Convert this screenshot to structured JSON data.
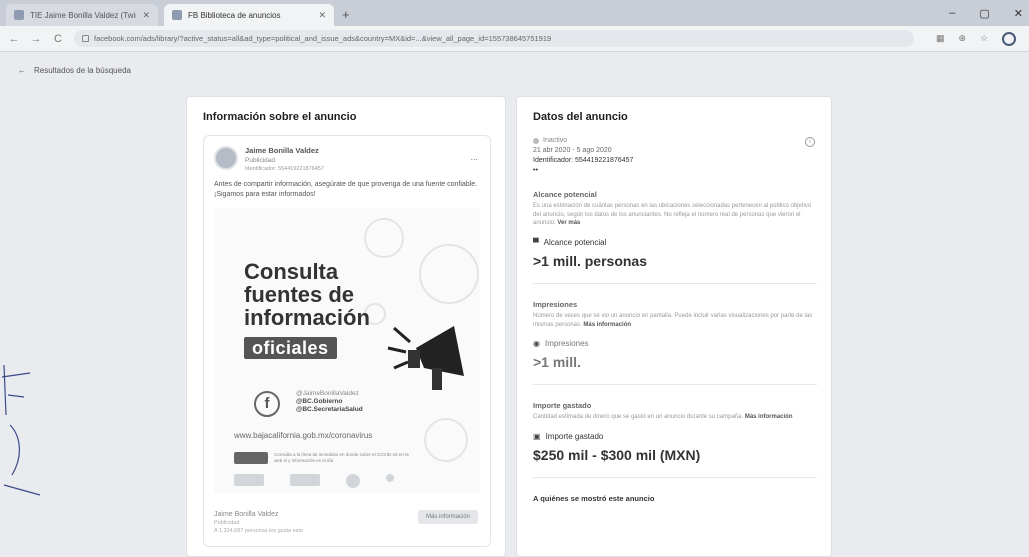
{
  "browser": {
    "tabs": [
      {
        "label": "TIE Jaime Bonilla Valdez (Twin)...",
        "active": false
      },
      {
        "label": "FB Biblioteca de anuncios",
        "active": true
      }
    ],
    "new_tab": "+",
    "window_controls": {
      "minimize": "–",
      "maximize": "▢",
      "close": "✕"
    },
    "nav": {
      "back": "←",
      "forward": "→",
      "reload": "C"
    },
    "url": "facebook.com/ads/library/?active_status=all&ad_type=political_and_issue_ads&country=MX&id=...&view_all_page_id=155738645751919"
  },
  "back_link": {
    "arrow": "←",
    "label": "Resultados de la búsqueda"
  },
  "left_panel": {
    "title": "Información sobre el anuncio",
    "ad": {
      "page_name": "Jaime Bonilla Valdez",
      "sponsored": "Publicidad",
      "sponsor_line": "Identificador: 554419221876457",
      "more": "...",
      "text": "Antes de compartir información, asegúrate de que provenga de una fuente confiable. ¡Sigamos para estar informados!",
      "creative": {
        "headline": [
          "Consulta",
          "fuentes de",
          "información"
        ],
        "highlight": "oficiales",
        "fb_letter": "f",
        "handles": [
          "@JaimeBonillaValdez",
          "@BC.Gobierno",
          "@BC.SecretariaSalud"
        ],
        "website": "www.bajacalifornia.gob.mx/coronavirus",
        "notice": "Consulta a la línea de inmediato en donde sobre el COVID-19 en la web el y información es el día"
      },
      "footer_name": "Jaime Bonilla Valdez",
      "footer_sub": "Publicidad",
      "footer_likes": "A 1,324,687 personas les gusta esto",
      "more_info_button": "Más información"
    }
  },
  "right_panel": {
    "title": "Datos del anuncio",
    "status": "Inactivo",
    "date_range": "21 abr 2020 - 5 ago 2020",
    "identifier": "Identificador: 554419221876457",
    "extra_mark": "••",
    "potential_reach": {
      "section_title": "Alcance potencial",
      "description": "Es una estimación de cuántas personas en las ubicaciones seleccionadas pertenecen al público objetivo del anuncio, según los datos de los anunciantes. No refleja el número real de personas que vieron el anuncio.",
      "see_more": "Ver más",
      "label": "Alcance potencial",
      "value": ">1 mill. personas"
    },
    "impressions": {
      "section_title": "Impresiones",
      "description": "Número de veces que se vio un anuncio en pantalla. Puede incluir varias visualizaciones por parte de las mismas personas.",
      "link": "Más información",
      "label": "Impresiones",
      "value": ">1 mill."
    },
    "spend": {
      "section_title": "Importe gastado",
      "description": "Cantidad estimada de dinero que se gastó en un anuncio durante su campaña.",
      "link": "Más información",
      "label": "Importe gastado",
      "value": "$250 mil - $300 mil (MXN)"
    },
    "audience_title": "A quiénes se mostró este anuncio"
  }
}
